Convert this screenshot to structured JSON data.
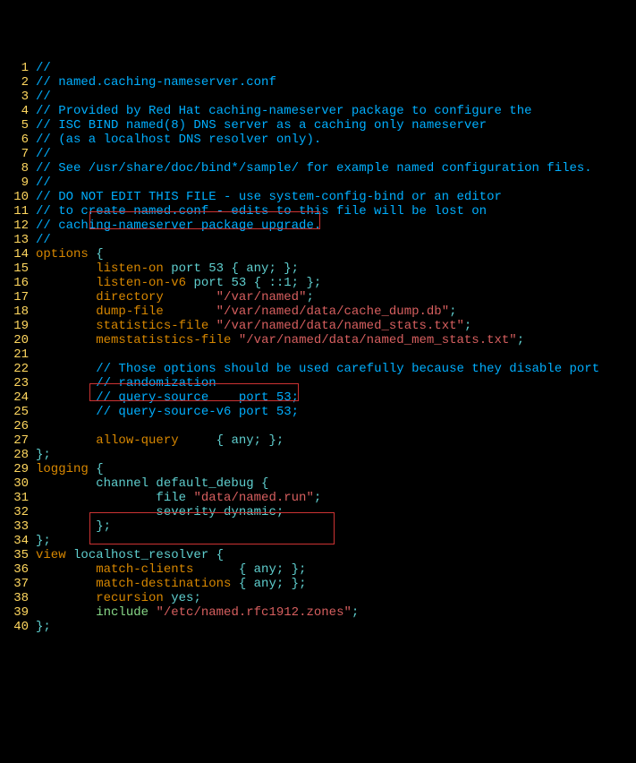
{
  "lines": [
    {
      "n": "1",
      "parts": [
        [
          "comment",
          "//"
        ]
      ]
    },
    {
      "n": "2",
      "parts": [
        [
          "comment",
          "// named.caching-nameserver.conf"
        ]
      ]
    },
    {
      "n": "3",
      "parts": [
        [
          "comment",
          "//"
        ]
      ]
    },
    {
      "n": "4",
      "parts": [
        [
          "comment",
          "// Provided by Red Hat caching-nameserver package to configure the"
        ]
      ]
    },
    {
      "n": "5",
      "parts": [
        [
          "comment",
          "// ISC BIND named(8) DNS server as a caching only nameserver"
        ]
      ]
    },
    {
      "n": "6",
      "parts": [
        [
          "comment",
          "// (as a localhost DNS resolver only)."
        ]
      ]
    },
    {
      "n": "7",
      "parts": [
        [
          "comment",
          "//"
        ]
      ]
    },
    {
      "n": "8",
      "parts": [
        [
          "comment",
          "// See /usr/share/doc/bind*/sample/ for example named configuration files."
        ]
      ]
    },
    {
      "n": "9",
      "parts": [
        [
          "comment",
          "//"
        ]
      ]
    },
    {
      "n": "10",
      "parts": [
        [
          "comment",
          "// DO NOT EDIT THIS FILE - use system-config-bind or an editor"
        ]
      ]
    },
    {
      "n": "11",
      "parts": [
        [
          "comment",
          "// to create named.conf - edits to this file will be lost on"
        ]
      ]
    },
    {
      "n": "12",
      "parts": [
        [
          "comment",
          "// caching-nameserver package upgrade."
        ]
      ]
    },
    {
      "n": "13",
      "parts": [
        [
          "comment",
          "//"
        ]
      ]
    },
    {
      "n": "14",
      "parts": [
        [
          "keyword",
          "options"
        ],
        [
          "plain",
          " {"
        ]
      ]
    },
    {
      "n": "15",
      "parts": [
        [
          "plain",
          "        "
        ],
        [
          "keyword",
          "listen-on"
        ],
        [
          "plain",
          " port 53 { any; };"
        ]
      ]
    },
    {
      "n": "16",
      "parts": [
        [
          "plain",
          "        "
        ],
        [
          "keyword",
          "listen-on-v6"
        ],
        [
          "plain",
          " port 53 { ::1; };"
        ]
      ]
    },
    {
      "n": "17",
      "parts": [
        [
          "plain",
          "        "
        ],
        [
          "keyword",
          "directory"
        ],
        [
          "plain",
          "       "
        ],
        [
          "string",
          "\"/var/named\""
        ],
        [
          "plain",
          ";"
        ]
      ]
    },
    {
      "n": "18",
      "parts": [
        [
          "plain",
          "        "
        ],
        [
          "keyword",
          "dump-file"
        ],
        [
          "plain",
          "       "
        ],
        [
          "string",
          "\"/var/named/data/cache_dump.db\""
        ],
        [
          "plain",
          ";"
        ]
      ]
    },
    {
      "n": "19",
      "parts": [
        [
          "plain",
          "        "
        ],
        [
          "keyword",
          "statistics-file"
        ],
        [
          "plain",
          " "
        ],
        [
          "string",
          "\"/var/named/data/named_stats.txt\""
        ],
        [
          "plain",
          ";"
        ]
      ]
    },
    {
      "n": "20",
      "parts": [
        [
          "plain",
          "        "
        ],
        [
          "keyword",
          "memstatistics-file"
        ],
        [
          "plain",
          " "
        ],
        [
          "string",
          "\"/var/named/data/named_mem_stats.txt\""
        ],
        [
          "plain",
          ";"
        ]
      ]
    },
    {
      "n": "21",
      "parts": [
        [
          "plain",
          ""
        ]
      ]
    },
    {
      "n": "22",
      "parts": [
        [
          "plain",
          "        "
        ],
        [
          "comment",
          "// Those options should be used carefully because they disable port"
        ]
      ]
    },
    {
      "n": "23",
      "parts": [
        [
          "plain",
          "        "
        ],
        [
          "comment",
          "// randomization"
        ]
      ]
    },
    {
      "n": "24",
      "parts": [
        [
          "plain",
          "        "
        ],
        [
          "comment",
          "// query-source    port 53;"
        ]
      ]
    },
    {
      "n": "25",
      "parts": [
        [
          "plain",
          "        "
        ],
        [
          "comment",
          "// query-source-v6 port 53;"
        ]
      ]
    },
    {
      "n": "26",
      "parts": [
        [
          "plain",
          ""
        ]
      ]
    },
    {
      "n": "27",
      "parts": [
        [
          "plain",
          "        "
        ],
        [
          "keyword",
          "allow-query"
        ],
        [
          "plain",
          "     { any; };"
        ]
      ]
    },
    {
      "n": "28",
      "parts": [
        [
          "plain",
          "};"
        ]
      ]
    },
    {
      "n": "29",
      "parts": [
        [
          "keyword",
          "logging"
        ],
        [
          "plain",
          " {"
        ]
      ]
    },
    {
      "n": "30",
      "parts": [
        [
          "plain",
          "        channel default_debug {"
        ]
      ]
    },
    {
      "n": "31",
      "parts": [
        [
          "plain",
          "                file "
        ],
        [
          "string",
          "\"data/named.run\""
        ],
        [
          "plain",
          ";"
        ]
      ]
    },
    {
      "n": "32",
      "parts": [
        [
          "plain",
          "                severity dynamic;"
        ]
      ]
    },
    {
      "n": "33",
      "parts": [
        [
          "plain",
          "        };"
        ]
      ]
    },
    {
      "n": "34",
      "parts": [
        [
          "plain",
          "};"
        ]
      ]
    },
    {
      "n": "35",
      "parts": [
        [
          "keyword",
          "view"
        ],
        [
          "plain",
          " localhost_resolver {"
        ]
      ]
    },
    {
      "n": "36",
      "parts": [
        [
          "plain",
          "        "
        ],
        [
          "keyword",
          "match-clients"
        ],
        [
          "plain",
          "      { any; };"
        ]
      ]
    },
    {
      "n": "37",
      "parts": [
        [
          "plain",
          "        "
        ],
        [
          "keyword",
          "match-destinations"
        ],
        [
          "plain",
          " { any; };"
        ]
      ]
    },
    {
      "n": "38",
      "parts": [
        [
          "plain",
          "        "
        ],
        [
          "keyword",
          "recursion"
        ],
        [
          "plain",
          " yes;"
        ]
      ]
    },
    {
      "n": "39",
      "parts": [
        [
          "plain",
          "        "
        ],
        [
          "type",
          "include"
        ],
        [
          "plain",
          " "
        ],
        [
          "string",
          "\"/etc/named.rfc1912.zones\""
        ],
        [
          "plain",
          ";"
        ]
      ]
    },
    {
      "n": "40",
      "parts": [
        [
          "plain",
          "};"
        ]
      ]
    }
  ]
}
